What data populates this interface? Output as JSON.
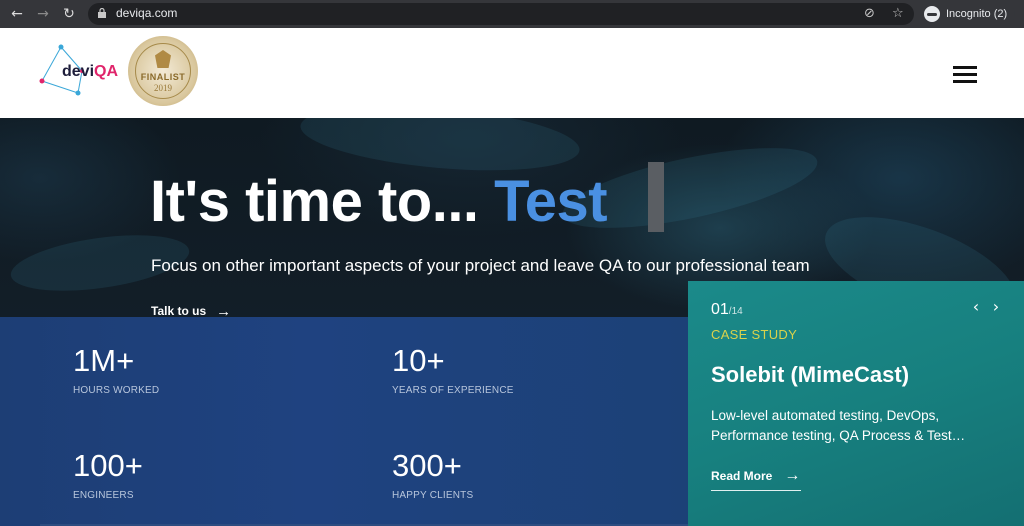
{
  "browser": {
    "url": "deviqa.com",
    "profile_label": "Incognito (2)"
  },
  "header": {
    "logo_prefix": "devi",
    "logo_suffix": "QA",
    "badge_label": "FINALIST",
    "badge_year": "2019"
  },
  "hero": {
    "headline_prefix": "It's time to... ",
    "headline_accent": "Test",
    "tagline": "Focus on other important aspects of your project and leave QA to our professional team",
    "cta_label": "Talk to us"
  },
  "stats": [
    {
      "value": "1M+",
      "label": "HOURS WORKED"
    },
    {
      "value": "10+",
      "label": "YEARS OF EXPERIENCE"
    },
    {
      "value": "100+",
      "label": "ENGINEERS"
    },
    {
      "value": "300+",
      "label": "HAPPY CLIENTS"
    }
  ],
  "case_study": {
    "index": "01",
    "total": "/14",
    "type": "CASE STUDY",
    "title": "Solebit (MimeCast)",
    "description": "Low-level automated testing, DevOps, Performance testing, QA Process & Test…",
    "cta_label": "Read More"
  },
  "colors": {
    "accent": "#4a90e2",
    "logo_accent": "#e0256b",
    "stats_band": "#1f4280",
    "card": "#17807f",
    "case_type": "#d9d24c"
  }
}
